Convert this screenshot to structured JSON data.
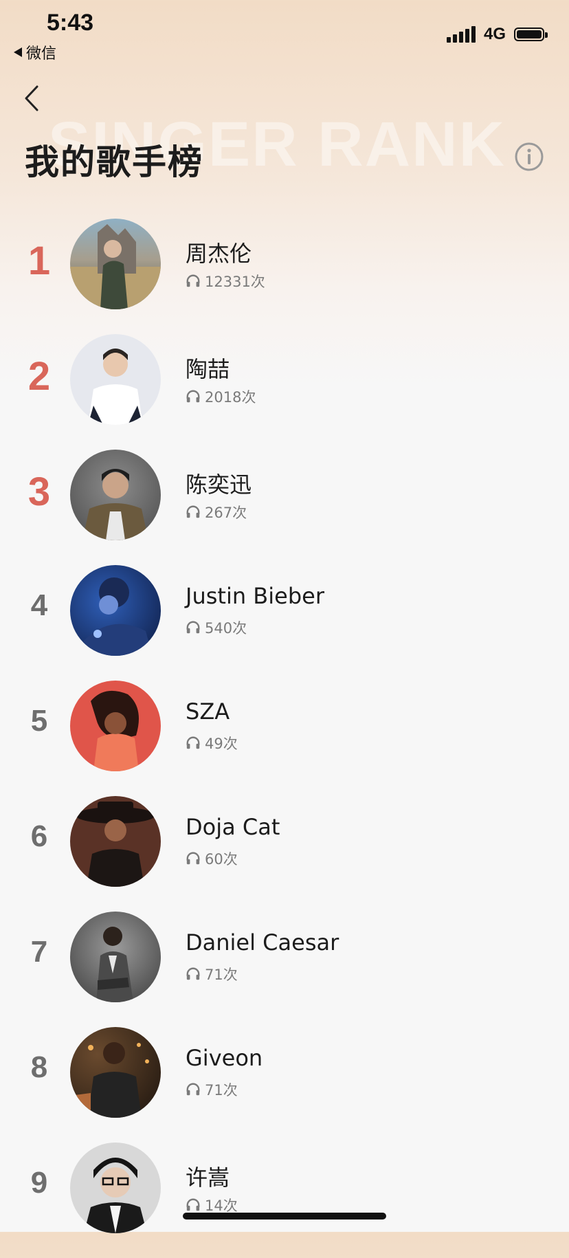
{
  "status_bar": {
    "time": "5:43",
    "back_app": "微信",
    "network": "4G"
  },
  "header": {
    "title": "我的歌手榜",
    "background_text": "SINGER RANK"
  },
  "colors": {
    "top_rank": "#d9665a",
    "rank": "#6e6e6e"
  },
  "singers": [
    {
      "rank": "1",
      "name": "周杰伦",
      "plays": "12331次"
    },
    {
      "rank": "2",
      "name": "陶喆",
      "plays": "2018次"
    },
    {
      "rank": "3",
      "name": "陈奕迅",
      "plays": "267次"
    },
    {
      "rank": "4",
      "name": "Justin Bieber",
      "plays": "540次"
    },
    {
      "rank": "5",
      "name": "SZA",
      "plays": "49次"
    },
    {
      "rank": "6",
      "name": "Doja Cat",
      "plays": "60次"
    },
    {
      "rank": "7",
      "name": "Daniel Caesar",
      "plays": "71次"
    },
    {
      "rank": "8",
      "name": "Giveon",
      "plays": "71次"
    },
    {
      "rank": "9",
      "name": "许嵩",
      "plays": "14次"
    }
  ]
}
